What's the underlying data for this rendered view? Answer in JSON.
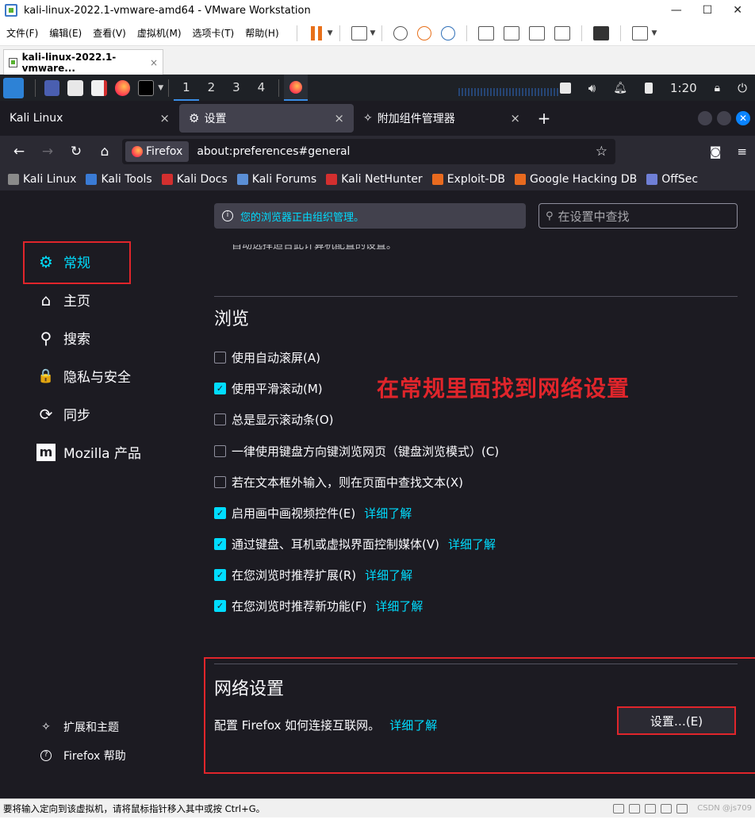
{
  "vmware": {
    "title": "kali-linux-2022.1-vmware-amd64 - VMware Workstation",
    "window_controls": [
      "—",
      "☐",
      "✕"
    ],
    "menu": [
      "文件(F)",
      "编辑(E)",
      "查看(V)",
      "虚拟机(M)",
      "选项卡(T)",
      "帮助(H)"
    ],
    "tab_label": "kali-linux-2022.1-vmware...",
    "tab_close": "×",
    "status_text": "要将输入定向到该虚拟机，请将鼠标指针移入其中或按 Ctrl+G。",
    "watermark": "CSDN @js709"
  },
  "kali_panel": {
    "workspaces": [
      "1",
      "2",
      "3",
      "4"
    ],
    "active_workspace": 0,
    "clock": "1:20"
  },
  "firefox": {
    "tabs": [
      {
        "label": "Kali Linux",
        "close": "×"
      },
      {
        "label": "设置",
        "close": "×"
      },
      {
        "label": "附加组件管理器",
        "close": "×"
      }
    ],
    "new_tab": "+",
    "url_badge": "Firefox",
    "url": "about:preferences#general",
    "bookmarks": [
      {
        "label": "Kali Linux",
        "color": "#8a8a8a"
      },
      {
        "label": "Kali Tools",
        "color": "#3a7bd5"
      },
      {
        "label": "Kali Docs",
        "color": "#d32f2f"
      },
      {
        "label": "Kali Forums",
        "color": "#5b8fd6"
      },
      {
        "label": "Kali NetHunter",
        "color": "#d32f2f"
      },
      {
        "label": "Exploit-DB",
        "color": "#e86a1f"
      },
      {
        "label": "Google Hacking DB",
        "color": "#e86a1f"
      },
      {
        "label": "OffSec",
        "color": "#6f7fd6"
      }
    ]
  },
  "prefs": {
    "categories": [
      {
        "label": "常规",
        "icon": "gear-icon",
        "glyph": "⚙"
      },
      {
        "label": "主页",
        "icon": "home-icon",
        "glyph": "⌂"
      },
      {
        "label": "搜索",
        "icon": "search-icon",
        "glyph": "⚲"
      },
      {
        "label": "隐私与安全",
        "icon": "lock-icon",
        "glyph": "🔒"
      },
      {
        "label": "同步",
        "icon": "sync-icon",
        "glyph": "⟳"
      },
      {
        "label": "Mozilla 产品",
        "icon": "mozilla-icon",
        "glyph": "m"
      }
    ],
    "footer_links": [
      {
        "label": "扩展和主题",
        "icon": "puzzle-icon",
        "glyph": "✧"
      },
      {
        "label": "Firefox 帮助",
        "icon": "help-icon",
        "glyph": "?"
      }
    ],
    "org_notice": "您的浏览器正由组织管理。",
    "search_placeholder": "在设置中查找",
    "cut_text": "自动选择适合此计算机配置的设置。",
    "browsing_title": "浏览",
    "options": [
      {
        "label": "使用自动滚屏(A)",
        "checked": false,
        "learn_more": ""
      },
      {
        "label": "使用平滑滚动(M)",
        "checked": true,
        "learn_more": ""
      },
      {
        "label": "总是显示滚动条(O)",
        "checked": false,
        "learn_more": ""
      },
      {
        "label": "一律使用键盘方向键浏览网页（键盘浏览模式）(C)",
        "checked": false,
        "learn_more": ""
      },
      {
        "label": "若在文本框外输入，则在页面中查找文本(X)",
        "checked": false,
        "learn_more": ""
      },
      {
        "label": "启用画中画视频控件(E)",
        "checked": true,
        "learn_more": "详细了解"
      },
      {
        "label": "通过键盘、耳机或虚拟界面控制媒体(V)",
        "checked": true,
        "learn_more": "详细了解"
      },
      {
        "label": "在您浏览时推荐扩展(R)",
        "checked": true,
        "learn_more": "详细了解"
      },
      {
        "label": "在您浏览时推荐新功能(F)",
        "checked": true,
        "learn_more": "详细了解"
      }
    ],
    "annotation": "在常规里面找到网络设置",
    "network": {
      "title": "网络设置",
      "description": "配置 Firefox 如何连接互联网。",
      "learn_more": "详细了解",
      "button": "设置…(E)"
    }
  }
}
